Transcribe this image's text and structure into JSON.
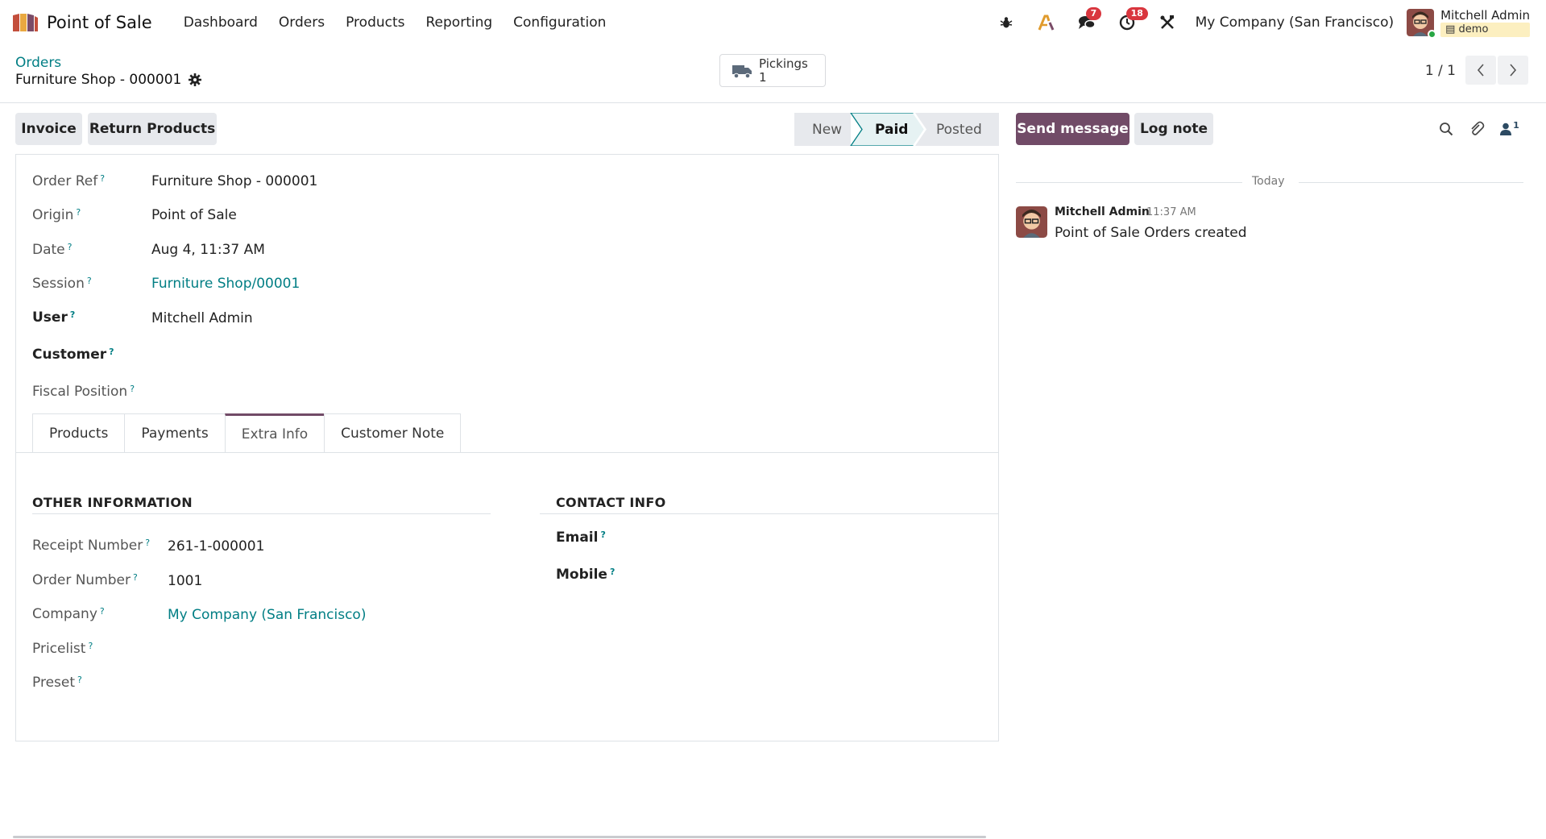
{
  "nav": {
    "app_name": "Point of Sale",
    "menu": [
      "Dashboard",
      "Orders",
      "Products",
      "Reporting",
      "Configuration"
    ],
    "messages_count": "7",
    "activities_count": "18",
    "company": "My Company (San Francisco)",
    "user_name": "Mitchell Admin",
    "database": "demo"
  },
  "control": {
    "breadcrumb": "Orders",
    "record_title": "Furniture Shop - 000001",
    "smart_button": {
      "label": "Pickings",
      "count": "1"
    },
    "pager": "1 / 1"
  },
  "actions": {
    "invoice": "Invoice",
    "return_products": "Return Products"
  },
  "status": {
    "steps": [
      "New",
      "Paid",
      "Posted"
    ],
    "current": "Paid"
  },
  "form": {
    "order_ref": {
      "label": "Order Ref",
      "value": "Furniture Shop - 000001"
    },
    "origin": {
      "label": "Origin",
      "value": "Point of Sale"
    },
    "date": {
      "label": "Date",
      "value": "Aug 4, 11:37 AM"
    },
    "session": {
      "label": "Session",
      "value": "Furniture Shop/00001"
    },
    "user": {
      "label": "User",
      "value": "Mitchell Admin"
    },
    "customer": {
      "label": "Customer"
    },
    "fiscal_position": {
      "label": "Fiscal Position"
    }
  },
  "tabs": [
    "Products",
    "Payments",
    "Extra Info",
    "Customer Note"
  ],
  "active_tab": "Extra Info",
  "extra_info": {
    "other_title": "OTHER INFORMATION",
    "receipt_number": {
      "label": "Receipt Number",
      "value": "261-1-000001"
    },
    "order_number": {
      "label": "Order Number",
      "value": "1001"
    },
    "company": {
      "label": "Company",
      "value": "My Company (San Francisco)"
    },
    "pricelist": {
      "label": "Pricelist"
    },
    "preset": {
      "label": "Preset"
    },
    "contact_title": "CONTACT INFO",
    "email": {
      "label": "Email"
    },
    "mobile": {
      "label": "Mobile"
    }
  },
  "chatter": {
    "send_message": "Send message",
    "log_note": "Log note",
    "followers_count": "1",
    "date_separator": "Today",
    "message": {
      "author": "Mitchell Admin",
      "time": "11:37 AM",
      "body": "Point of Sale Orders created"
    }
  },
  "colors": {
    "brand_purple": "#714b67",
    "link_teal": "#017e84",
    "badge_red": "#d9363e"
  },
  "icons": [
    "pos-logo-icon",
    "bug-icon",
    "ai-icon",
    "chat-icon",
    "clock-icon",
    "tools-icon",
    "gear-icon",
    "truck-icon",
    "chevron-left-icon",
    "chevron-right-icon",
    "search-icon",
    "paperclip-icon",
    "user-icon"
  ]
}
